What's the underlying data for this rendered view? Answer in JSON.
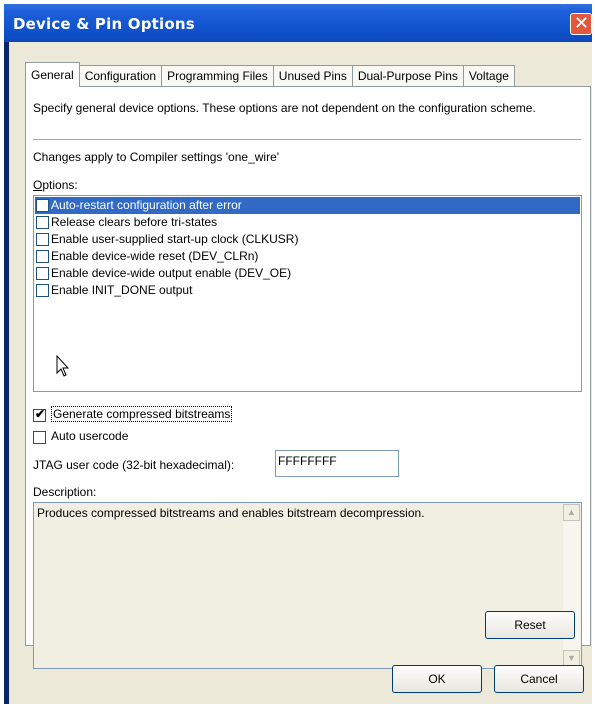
{
  "window": {
    "title": "Device & Pin Options"
  },
  "tabs": [
    {
      "label": "General"
    },
    {
      "label": "Configuration"
    },
    {
      "label": "Programming Files"
    },
    {
      "label": "Unused Pins"
    },
    {
      "label": "Dual-Purpose Pins"
    },
    {
      "label": "Voltage"
    }
  ],
  "general": {
    "hint": "Specify general device options.  These options are not dependent on the configuration scheme.",
    "changes_note": "Changes apply to Compiler settings 'one_wire'",
    "options_label": "Options:",
    "options": [
      {
        "label": "Auto-restart configuration after error",
        "checked": false,
        "selected": true
      },
      {
        "label": "Release clears before tri-states",
        "checked": false,
        "selected": false
      },
      {
        "label": "Enable user-supplied start-up clock (CLKUSR)",
        "checked": false,
        "selected": false
      },
      {
        "label": "Enable device-wide reset (DEV_CLRn)",
        "checked": false,
        "selected": false
      },
      {
        "label": "Enable device-wide output enable (DEV_OE)",
        "checked": false,
        "selected": false
      },
      {
        "label": "Enable INIT_DONE output",
        "checked": false,
        "selected": false
      }
    ],
    "compressed_label": "Generate compressed bitstreams",
    "compressed_checked": true,
    "auto_usercode_label": "Auto usercode",
    "auto_usercode_checked": false,
    "jtag_label": "JTAG user code (32-bit hexadecimal):",
    "jtag_value": "FFFFFFFF",
    "description_label": "Description:",
    "description_text": "Produces compressed bitstreams and enables bitstream decompression.",
    "reset_label": "Reset"
  },
  "footer": {
    "ok_label": "OK",
    "cancel_label": "Cancel"
  }
}
